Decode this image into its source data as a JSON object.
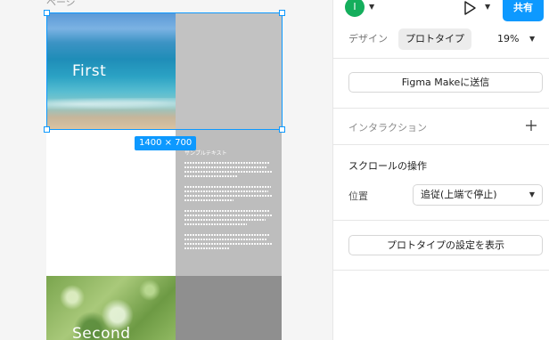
{
  "canvas": {
    "frame_label": "ページ",
    "hero_title": "First",
    "sample_title": "サンプルテキスト",
    "second_title": "Second",
    "size_badge": "1400 × 700"
  },
  "topbar": {
    "avatar_initial": "I",
    "share_label": "共有"
  },
  "tabs": {
    "design": "デザイン",
    "prototype": "プロトタイプ",
    "zoom": "19%"
  },
  "actions": {
    "figma_make": "Figma Makeに送信",
    "show_proto_settings": "プロトタイプの設定を表示"
  },
  "interactions": {
    "title": "インタラクション"
  },
  "scroll": {
    "title": "スクロールの操作",
    "position_label": "位置",
    "position_value": "追従(上端で停止)"
  },
  "colors": {
    "accent": "#0d99ff",
    "avatar": "#14ae5c"
  }
}
